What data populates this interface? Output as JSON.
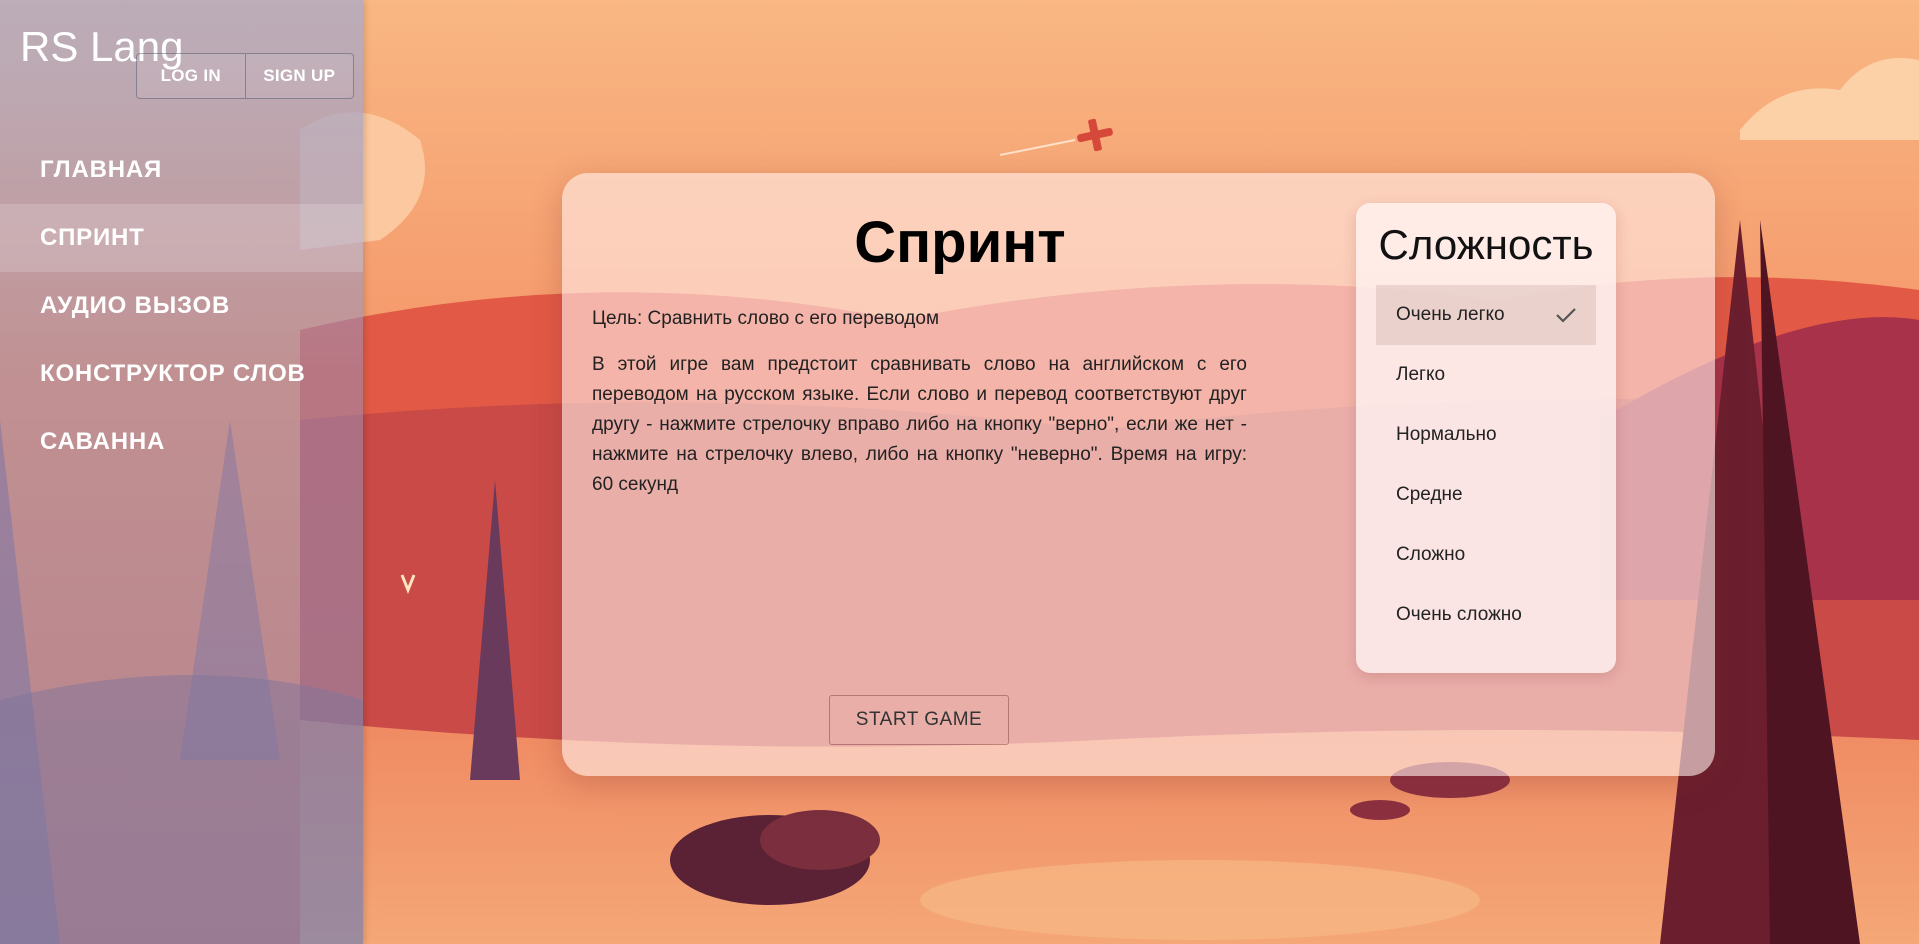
{
  "app": {
    "logo": "RS Lang"
  },
  "auth": {
    "login_label": "LOG IN",
    "signup_label": "SIGN UP"
  },
  "nav": {
    "items": [
      {
        "label": "ГЛАВНАЯ"
      },
      {
        "label": "СПРИНТ"
      },
      {
        "label": "АУДИО ВЫЗОВ"
      },
      {
        "label": "КОНСТРУКТОР СЛОВ"
      },
      {
        "label": "САВАННА"
      }
    ]
  },
  "game": {
    "title": "Спринт",
    "goal": "Цель: Сравнить слово с его переводом",
    "description": "В этой игре вам предстоит сравнивать слово на английском с его переводом на русском языке. Если слово и перевод соответствуют друг другу - нажмите стрелочку вправо либо на кнопку \"верно\", если же нет - нажмите на стрелочку влево, либо на кнопку \"неверно\". Время на игру: 60 секунд",
    "start_label": "START GAME"
  },
  "difficulty": {
    "title": "Сложность",
    "options": [
      {
        "label": "Очень легко"
      },
      {
        "label": "Легко"
      },
      {
        "label": "Нормально"
      },
      {
        "label": "Средне"
      },
      {
        "label": "Сложно"
      },
      {
        "label": "Очень сложно"
      }
    ],
    "selected_label": "Очень легко"
  },
  "colors": {
    "sky_top": "#f8b07a",
    "sky_low": "#ee7a55",
    "sidebar_active": "#ffffff2e"
  },
  "icons": {
    "selected": "check-icon",
    "plane": "airplane-icon"
  }
}
